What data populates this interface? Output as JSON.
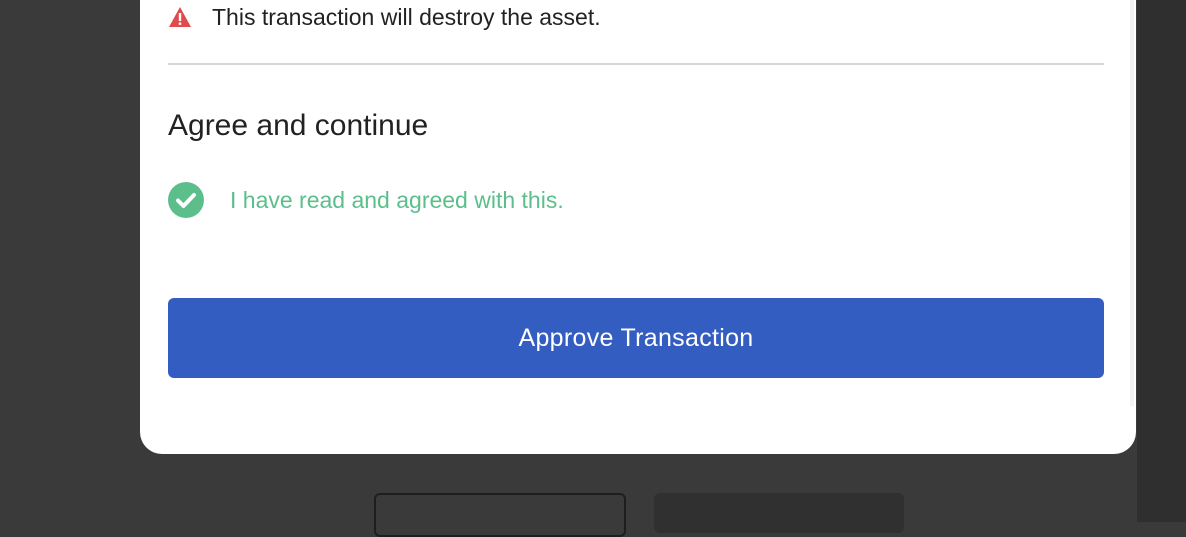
{
  "modal": {
    "warning_text": "This transaction will destroy the asset.",
    "section_title": "Agree and continue",
    "agreement_text": "I have read and agreed with this.",
    "approve_button_label": "Approve Transaction",
    "agreement_checked": true
  },
  "icons": {
    "warning": "warning-triangle-icon",
    "check": "check-circle-icon"
  },
  "colors": {
    "backdrop": "#3a3a3a",
    "warning_red": "#e04b4b",
    "agree_green": "#5cbf8b",
    "approve_blue": "#335dc1"
  }
}
